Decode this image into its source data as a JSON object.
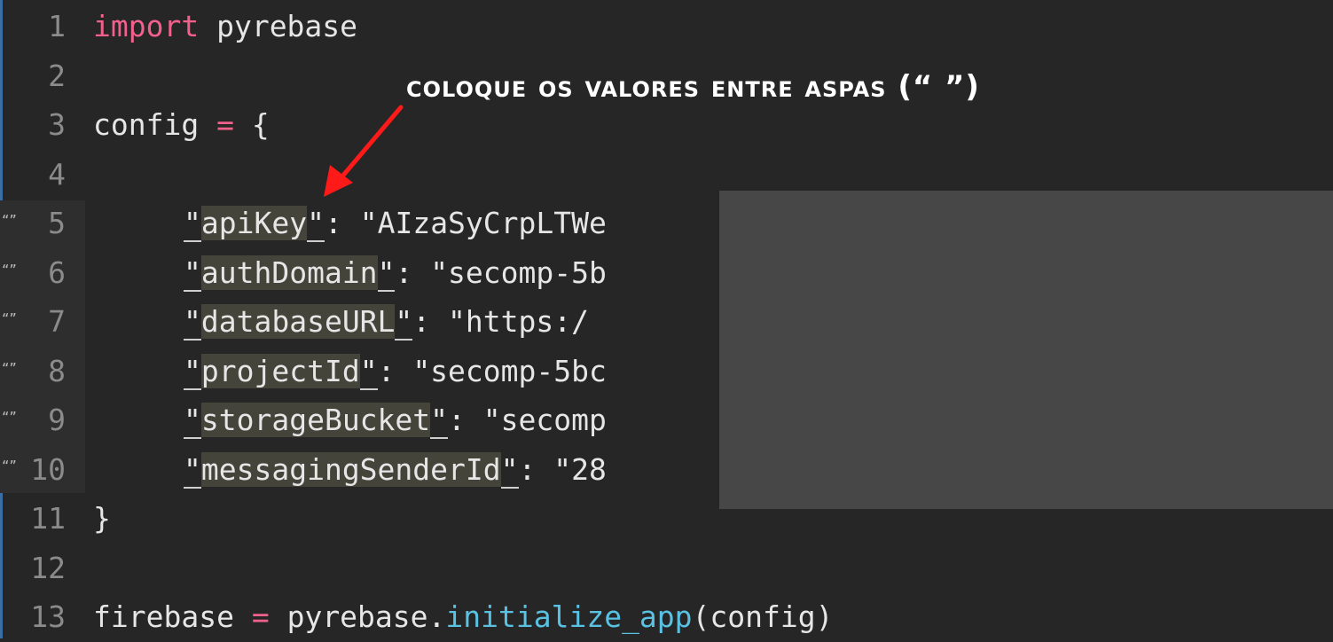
{
  "annotation": {
    "text": "coloque os valores entre aspas (“ ”)"
  },
  "gutter": {
    "marker": "“”"
  },
  "lines": [
    {
      "num": "1",
      "tokens": {
        "kw": "import",
        "rest": " pyrebase"
      }
    },
    {
      "num": "2"
    },
    {
      "num": "3",
      "tokens": {
        "name": "config",
        "eq": "=",
        "brace": "{"
      }
    },
    {
      "num": "4"
    },
    {
      "num": "5",
      "key": "apiKey",
      "value": "\"AIzaSyCrpLTWe"
    },
    {
      "num": "6",
      "key": "authDomain",
      "value": "\"secomp-5b"
    },
    {
      "num": "7",
      "key": "databaseURL",
      "value": "\"https:/"
    },
    {
      "num": "8",
      "key": "projectId",
      "value": "\"secomp-5bc"
    },
    {
      "num": "9",
      "key": "storageBucket",
      "value": "\"secomp"
    },
    {
      "num": "10",
      "key": "messagingSenderId",
      "value": "\"28"
    },
    {
      "num": "11",
      "tokens": {
        "brace": "}"
      }
    },
    {
      "num": "12"
    },
    {
      "num": "13",
      "tokens": {
        "name": "firebase",
        "eq": "=",
        "obj": "pyrebase.",
        "fn": "initialize_app",
        "args": "(config)"
      }
    }
  ],
  "colors": {
    "keyword": "#f2618c",
    "function": "#59c2e3",
    "arrow": "#ff1a1a",
    "redaction": "#474747"
  }
}
